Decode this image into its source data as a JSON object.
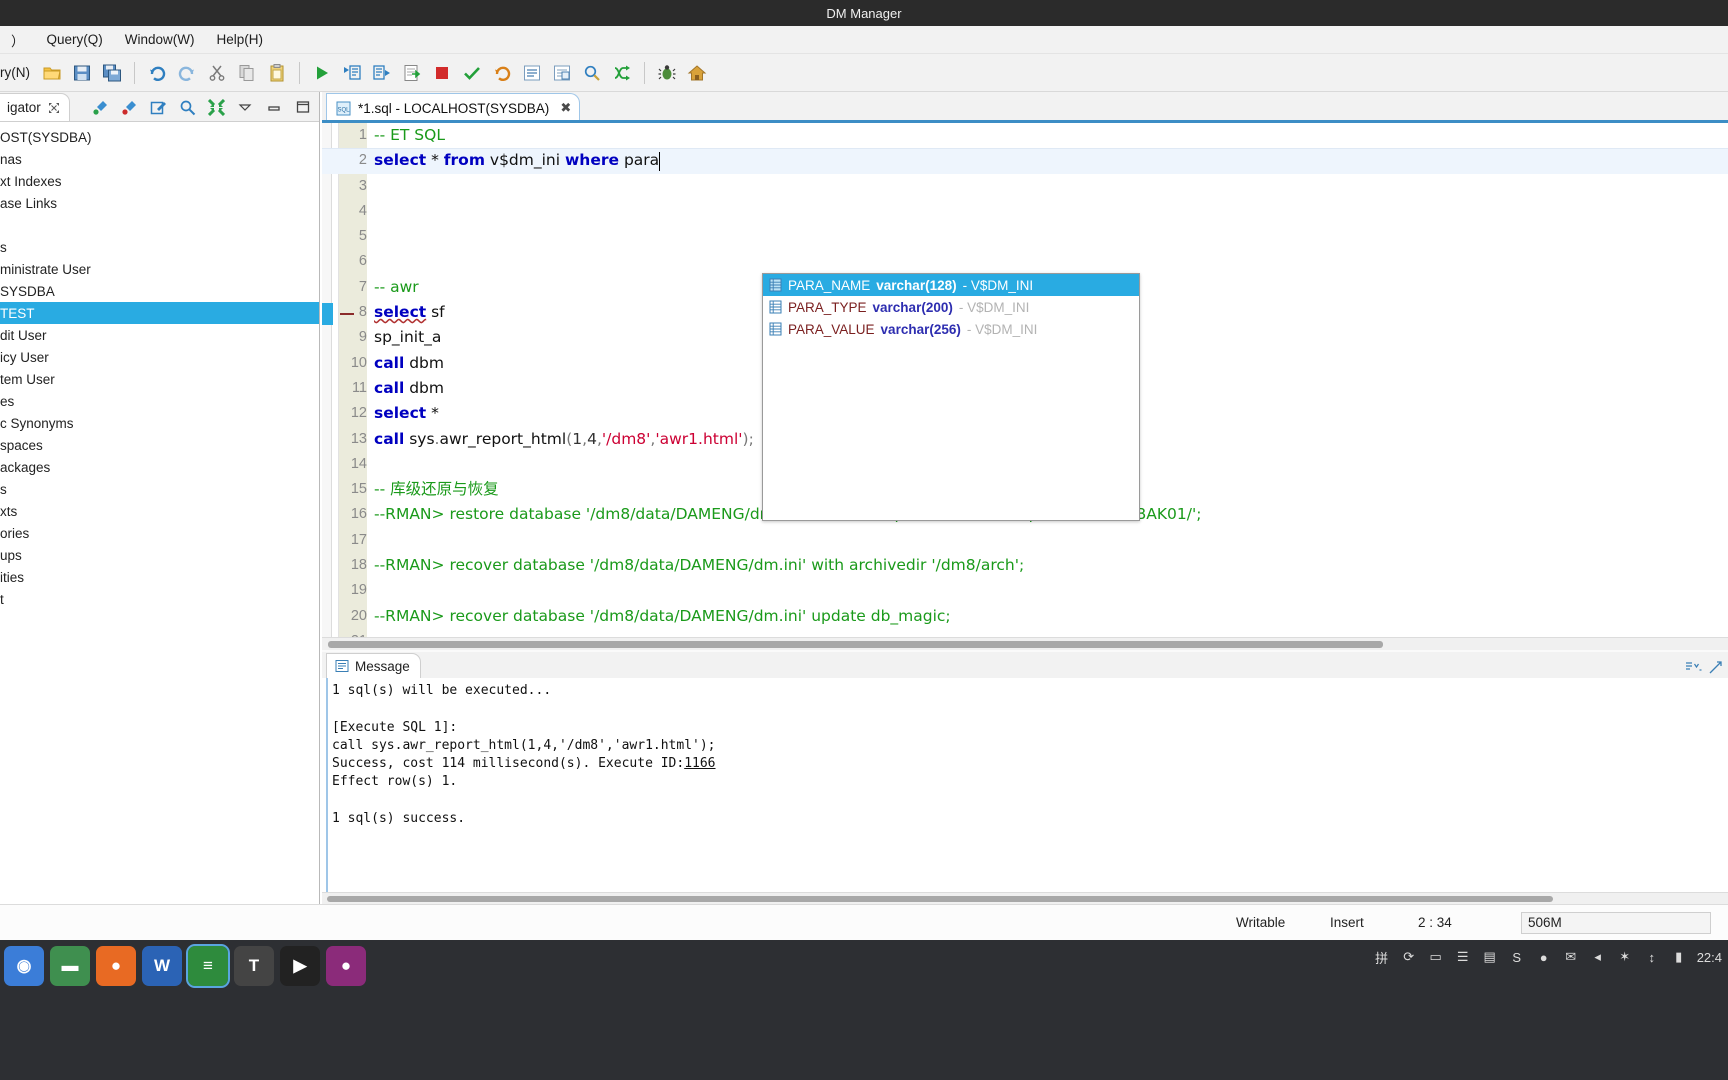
{
  "window": {
    "title": "DM Manager"
  },
  "menubar": {
    "items": [
      {
        "label": "）",
        "name": "menu-partial"
      },
      {
        "label": "Query(Q)",
        "name": "menu-query"
      },
      {
        "label": "Window(W)",
        "name": "menu-window"
      },
      {
        "label": "Help(H)",
        "name": "menu-help"
      }
    ]
  },
  "toolbar": {
    "new_query_label": "ry(N)",
    "buttons": [
      {
        "name": "open-folder-icon",
        "tooltip": "Open"
      },
      {
        "name": "save-icon",
        "tooltip": "Save"
      },
      {
        "name": "save-all-icon",
        "tooltip": "Save All"
      },
      {
        "name": "undo-icon",
        "tooltip": "Undo"
      },
      {
        "name": "redo-icon",
        "tooltip": "Redo"
      },
      {
        "name": "cut-icon",
        "tooltip": "Cut"
      },
      {
        "name": "copy-icon",
        "tooltip": "Copy"
      },
      {
        "name": "paste-icon",
        "tooltip": "Paste"
      },
      {
        "name": "execute-icon",
        "tooltip": "Execute"
      },
      {
        "name": "execute-step-icon",
        "tooltip": "Execute Step"
      },
      {
        "name": "execute-script-icon",
        "tooltip": "Execute Script"
      },
      {
        "name": "export-result-icon",
        "tooltip": "Export Result"
      },
      {
        "name": "stop-icon",
        "tooltip": "Stop"
      },
      {
        "name": "check-syntax-icon",
        "tooltip": "Check Syntax"
      },
      {
        "name": "rollback-icon",
        "tooltip": "Rollback"
      },
      {
        "name": "format-icon",
        "tooltip": "Format SQL"
      },
      {
        "name": "explain-plan-icon",
        "tooltip": "Explain Plan"
      },
      {
        "name": "find-icon",
        "tooltip": "Find"
      },
      {
        "name": "branch-icon",
        "tooltip": "Branch"
      },
      {
        "name": "debug-icon",
        "tooltip": "Debug"
      },
      {
        "name": "home-icon",
        "tooltip": "Home"
      }
    ]
  },
  "navigator": {
    "tab_label": "igator",
    "tools": [
      {
        "name": "connect-icon"
      },
      {
        "name": "disconnect-icon"
      },
      {
        "name": "edit-icon"
      },
      {
        "name": "search-icon"
      },
      {
        "name": "collapse-all-icon"
      },
      {
        "name": "view-menu-icon"
      },
      {
        "name": "minimize-icon"
      },
      {
        "name": "maximize-icon"
      }
    ],
    "tree": [
      {
        "label": "OST(SYSDBA)",
        "selected": false
      },
      {
        "label": "nas",
        "selected": false
      },
      {
        "label": "xt Indexes",
        "selected": false
      },
      {
        "label": "ase Links",
        "selected": false
      },
      {
        "label": "",
        "selected": false
      },
      {
        "label": "s",
        "selected": false
      },
      {
        "label": "ministrate User",
        "selected": false
      },
      {
        "label": "SYSDBA",
        "selected": false
      },
      {
        "label": "TEST",
        "selected": true
      },
      {
        "label": "dit User",
        "selected": false
      },
      {
        "label": "icy User",
        "selected": false
      },
      {
        "label": "tem User",
        "selected": false
      },
      {
        "label": "es",
        "selected": false
      },
      {
        "label": "c Synonyms",
        "selected": false
      },
      {
        "label": "spaces",
        "selected": false
      },
      {
        "label": "ackages",
        "selected": false
      },
      {
        "label": "s",
        "selected": false
      },
      {
        "label": "xts",
        "selected": false
      },
      {
        "label": "ories",
        "selected": false
      },
      {
        "label": "ups",
        "selected": false
      },
      {
        "label": "ities",
        "selected": false
      },
      {
        "label": "t",
        "selected": false
      }
    ]
  },
  "editor": {
    "tab": {
      "label": "*1.sql - LOCALHOST(SYSDBA)",
      "icon": "sql-file-icon",
      "close": "✖"
    },
    "lines": [
      {
        "no": "1",
        "segments": [
          {
            "t": "-- ET SQL",
            "c": "cmt"
          }
        ]
      },
      {
        "no": "2",
        "current": true,
        "segments": [
          {
            "t": "select",
            "c": "kw"
          },
          {
            "t": " * ",
            "c": "pl"
          },
          {
            "t": "from",
            "c": "kw"
          },
          {
            "t": " v$dm_ini ",
            "c": "pl"
          },
          {
            "t": "where",
            "c": "kw"
          },
          {
            "t": " para",
            "c": "pl"
          }
        ]
      },
      {
        "no": "3",
        "segments": []
      },
      {
        "no": "4",
        "segments": []
      },
      {
        "no": "5",
        "segments": []
      },
      {
        "no": "6",
        "segments": []
      },
      {
        "no": "7",
        "segments": [
          {
            "t": "-- awr",
            "c": "cmt"
          }
        ]
      },
      {
        "no": "8",
        "segments": [
          {
            "t": "select",
            "c": "kw"
          },
          {
            "t": " sf",
            "c": "pl"
          }
        ]
      },
      {
        "no": "9",
        "segments": [
          {
            "t": "sp_init_a",
            "c": "pl"
          }
        ]
      },
      {
        "no": "10",
        "segments": [
          {
            "t": "call",
            "c": "kw"
          },
          {
            "t": " dbm",
            "c": "pl"
          }
        ]
      },
      {
        "no": "11",
        "segments": [
          {
            "t": "call",
            "c": "kw"
          },
          {
            "t": " dbm",
            "c": "pl"
          }
        ]
      },
      {
        "no": "12",
        "segments": [
          {
            "t": "select",
            "c": "kw"
          },
          {
            "t": " *",
            "c": "pl"
          }
        ]
      },
      {
        "no": "13",
        "segments": [
          {
            "t": "call",
            "c": "kw"
          },
          {
            "t": " sys",
            "c": "pl"
          },
          {
            "t": ".",
            "c": "pun"
          },
          {
            "t": "awr_report_html",
            "c": "pl"
          },
          {
            "t": "(",
            "c": "pun"
          },
          {
            "t": "1",
            "c": "num"
          },
          {
            "t": ",",
            "c": "pun"
          },
          {
            "t": "4",
            "c": "num"
          },
          {
            "t": ",",
            "c": "pun"
          },
          {
            "t": "'/dm8'",
            "c": "str"
          },
          {
            "t": ",",
            "c": "pun"
          },
          {
            "t": "'awr1.html'",
            "c": "str"
          },
          {
            "t": ");",
            "c": "pun"
          }
        ]
      },
      {
        "no": "14",
        "segments": []
      },
      {
        "no": "15",
        "segments": [
          {
            "t": "-- 库级还原与恢复",
            "c": "cmt"
          }
        ]
      },
      {
        "no": "16",
        "segments": [
          {
            "t": "--RMAN> restore database '/dm8/data/DAMENG/dm.ini' from backupset '/dm8/backup/full/DMFULLBAK01/';",
            "c": "cmt"
          }
        ]
      },
      {
        "no": "17",
        "segments": []
      },
      {
        "no": "18",
        "segments": [
          {
            "t": "--RMAN> recover database '/dm8/data/DAMENG/dm.ini' with archivedir '/dm8/arch';",
            "c": "cmt"
          }
        ]
      },
      {
        "no": "19",
        "segments": []
      },
      {
        "no": "20",
        "segments": [
          {
            "t": "--RMAN> recover database '/dm8/data/DAMENG/dm.ini' update db_magic;",
            "c": "cmt"
          }
        ]
      },
      {
        "no": "21",
        "segments": []
      }
    ]
  },
  "autocomplete": {
    "items": [
      {
        "name": "PARA_NAME",
        "type": "varchar(128)",
        "source": "- V$DM_INI",
        "selected": true,
        "icon": "column-icon"
      },
      {
        "name": "PARA_TYPE",
        "type": "varchar(200)",
        "source": "- V$DM_INI",
        "selected": false,
        "icon": "column-icon"
      },
      {
        "name": "PARA_VALUE",
        "type": "varchar(256)",
        "source": "- V$DM_INI",
        "selected": false,
        "icon": "column-icon"
      }
    ]
  },
  "message": {
    "tab_label": "Message",
    "tab_icon": "message-icon",
    "tools": [
      {
        "name": "scroll-lock-icon"
      },
      {
        "name": "maximize-panel-icon"
      }
    ],
    "log_before_id": "1 sql(s) will be executed...\n\n[Execute SQL 1]:\ncall sys.awr_report_html(1,4,'/dm8','awr1.html');\nSuccess, cost 114 millisecond(s). Execute ID:",
    "execute_id": "1166",
    "log_after_id": "\nEffect row(s) 1.\n\n1 sql(s) success."
  },
  "statusbar": {
    "writable": "Writable",
    "insert": "Insert",
    "position": "2 : 34",
    "memory": "506M"
  },
  "taskbar": {
    "apps": [
      {
        "name": "taskbar-app-start",
        "glyph": "◉",
        "color": "#3b7dd8",
        "active": false
      },
      {
        "name": "taskbar-app-files",
        "glyph": "▬",
        "color": "#3f8f4f",
        "active": false
      },
      {
        "name": "taskbar-app-firefox",
        "glyph": "●",
        "color": "#e86a23",
        "active": false
      },
      {
        "name": "taskbar-app-writer",
        "glyph": "W",
        "color": "#2b63b5",
        "active": false
      },
      {
        "name": "taskbar-app-calc",
        "glyph": "≡",
        "color": "#2e8b3d",
        "active": true
      },
      {
        "name": "taskbar-app-terminal",
        "glyph": "T",
        "color": "#444444",
        "active": false
      },
      {
        "name": "taskbar-app-media",
        "glyph": "▶",
        "color": "#222222",
        "active": false
      },
      {
        "name": "taskbar-app-browser",
        "glyph": "●",
        "color": "#8b2b7a",
        "active": false
      }
    ],
    "tray": [
      {
        "name": "tray-input-method-icon",
        "glyph": "拼"
      },
      {
        "name": "tray-sync-icon",
        "glyph": "⟳"
      },
      {
        "name": "tray-display-icon",
        "glyph": "▭"
      },
      {
        "name": "tray-clipboard-icon",
        "glyph": "☰"
      },
      {
        "name": "tray-notes-icon",
        "glyph": "▤"
      },
      {
        "name": "tray-shield-icon",
        "glyph": "S"
      },
      {
        "name": "tray-lightbulb-icon",
        "glyph": "●"
      },
      {
        "name": "tray-mail-icon",
        "glyph": "✉"
      },
      {
        "name": "tray-volume-icon",
        "glyph": "◂"
      },
      {
        "name": "tray-bluetooth-icon",
        "glyph": "✶"
      },
      {
        "name": "tray-network-icon",
        "glyph": "↕"
      },
      {
        "name": "tray-battery-icon",
        "glyph": "▮"
      }
    ],
    "clock": "22:4"
  }
}
